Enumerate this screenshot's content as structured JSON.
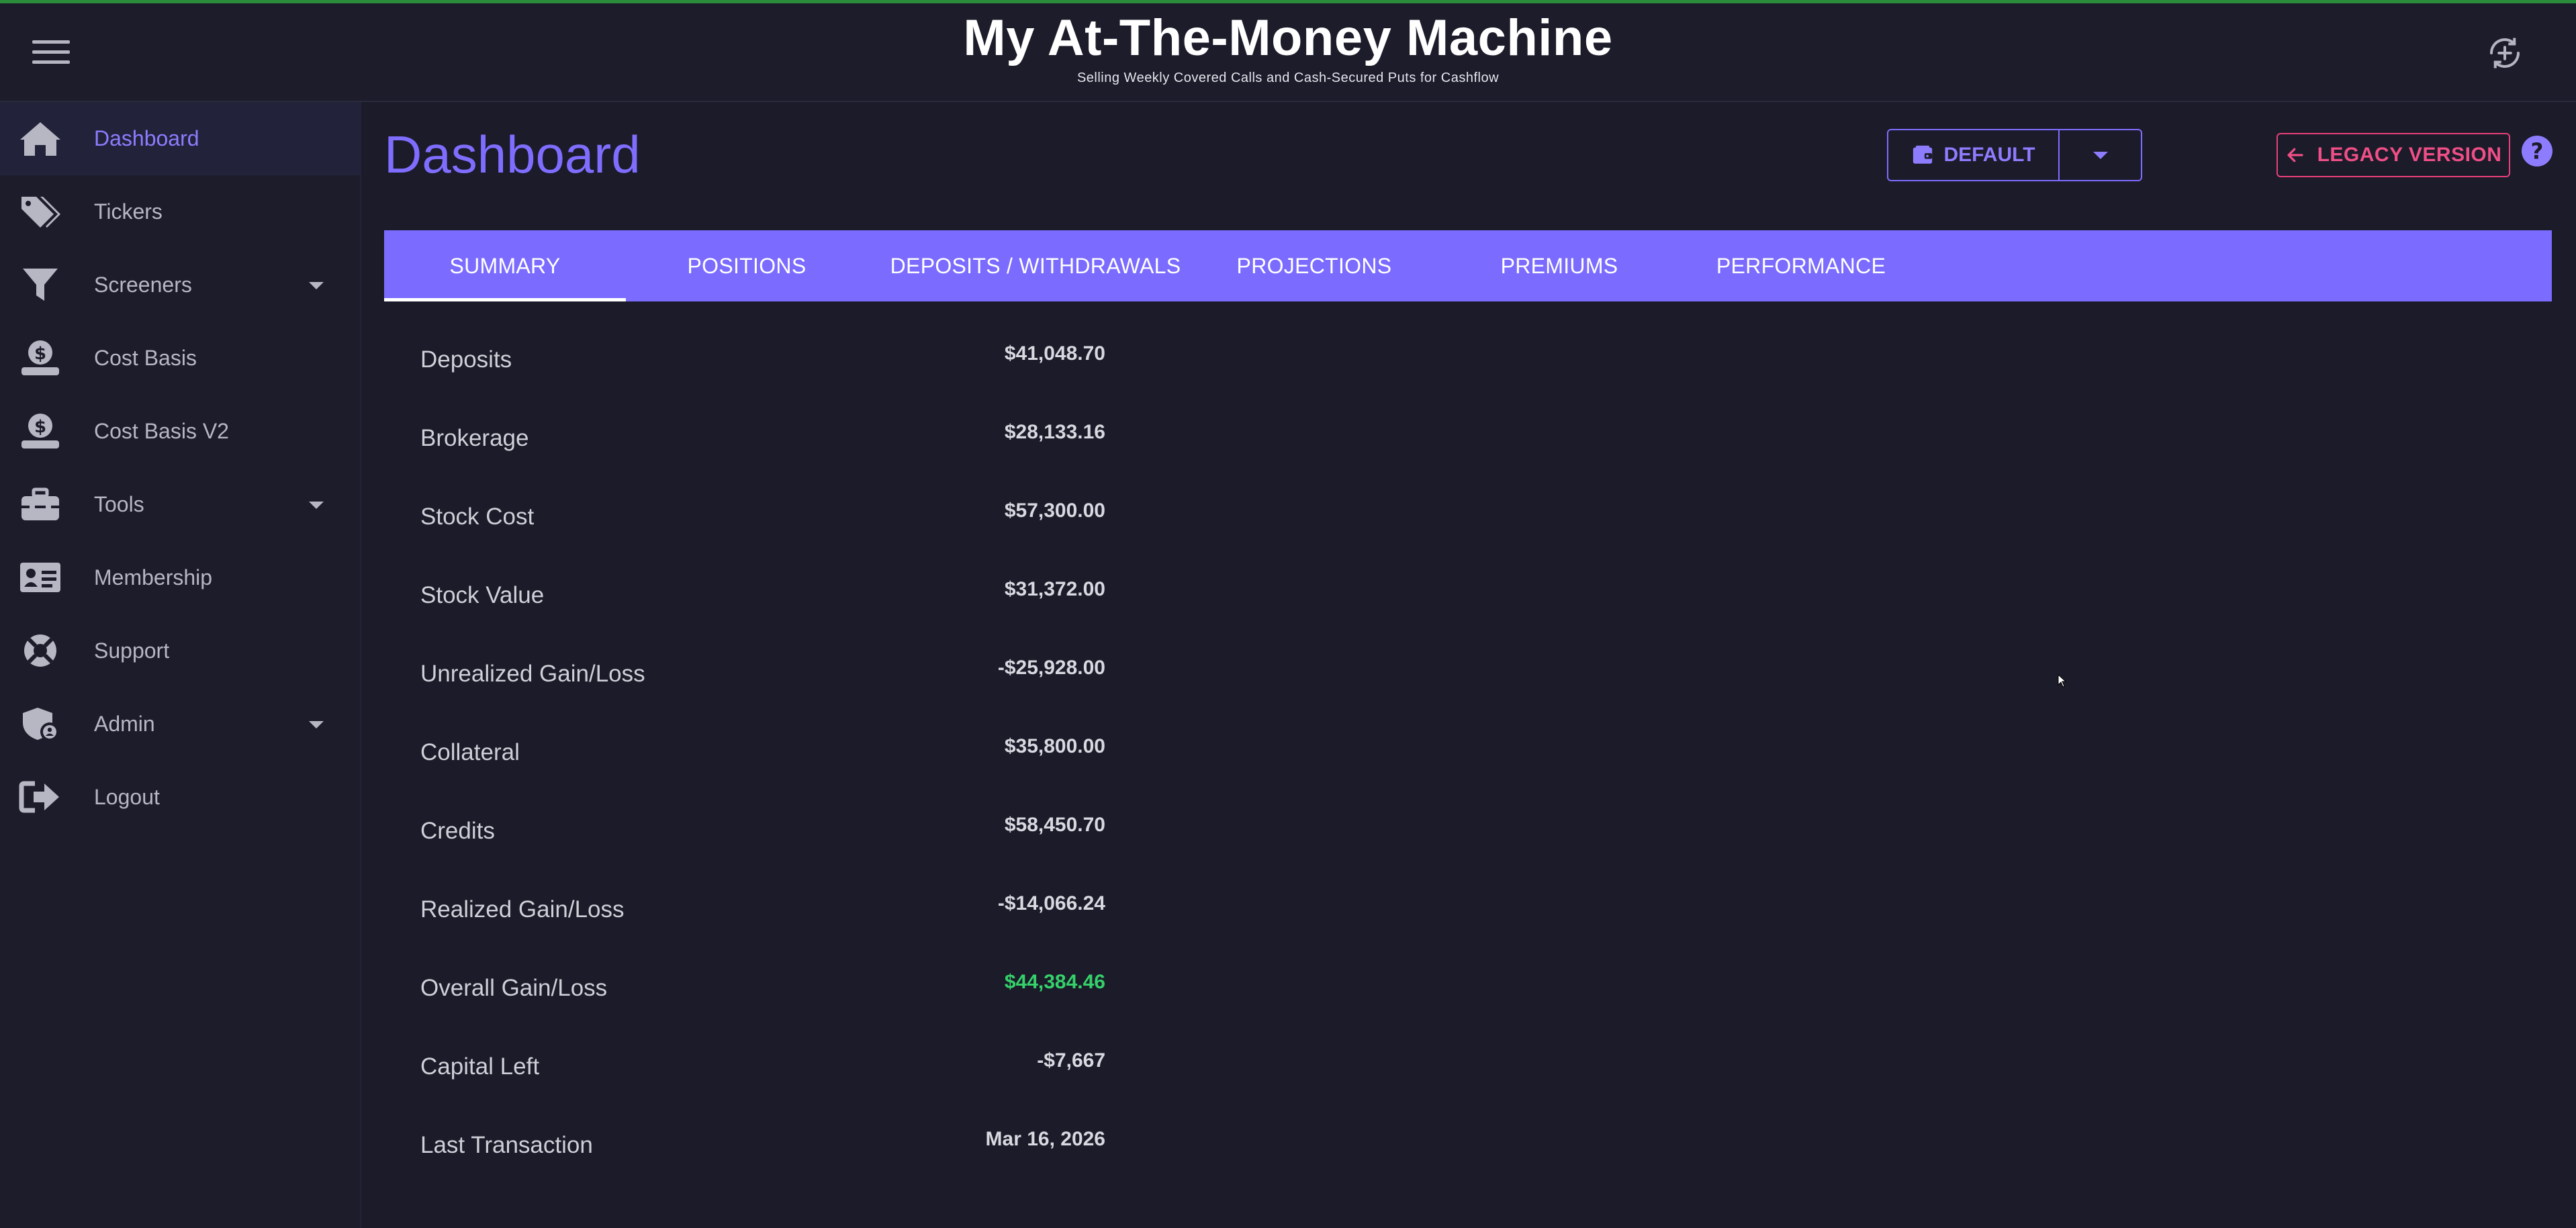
{
  "header": {
    "title": "My At-The-Money Machine",
    "subtitle": "Selling Weekly Covered Calls and Cash-Secured Puts for Cashflow",
    "menu_icon": "hamburger-menu-icon",
    "sync_icon": "sync-icon"
  },
  "sidebar": {
    "items": [
      {
        "label": "Dashboard",
        "icon": "home-icon",
        "active": true
      },
      {
        "label": "Tickers",
        "icon": "tags-icon"
      },
      {
        "label": "Screeners",
        "icon": "filter-icon",
        "expandable": true
      },
      {
        "label": "Cost Basis",
        "icon": "money-hand-icon"
      },
      {
        "label": "Cost Basis V2",
        "icon": "money-hand-icon"
      },
      {
        "label": "Tools",
        "icon": "toolbox-icon",
        "expandable": true
      },
      {
        "label": "Membership",
        "icon": "id-card-icon"
      },
      {
        "label": "Support",
        "icon": "life-ring-icon"
      },
      {
        "label": "Admin",
        "icon": "shield-user-icon",
        "expandable": true
      },
      {
        "label": "Logout",
        "icon": "sign-out-icon"
      }
    ]
  },
  "main": {
    "page_title": "Dashboard",
    "portfolio_button": "DEFAULT",
    "legacy_button": "LEGACY VERSION",
    "tabs": [
      {
        "label": "SUMMARY",
        "active": true
      },
      {
        "label": "POSITIONS"
      },
      {
        "label": "DEPOSITS / WITHDRAWALS"
      },
      {
        "label": "PROJECTIONS"
      },
      {
        "label": "PREMIUMS"
      },
      {
        "label": "PERFORMANCE"
      }
    ],
    "summary": [
      {
        "label": "Deposits",
        "value": "$41,048.70"
      },
      {
        "label": "Brokerage",
        "value": "$28,133.16"
      },
      {
        "label": "Stock Cost",
        "value": "$57,300.00"
      },
      {
        "label": "Stock Value",
        "value": "$31,372.00"
      },
      {
        "label": "Unrealized Gain/Loss",
        "value": "-$25,928.00"
      },
      {
        "label": "Collateral",
        "value": "$35,800.00"
      },
      {
        "label": "Credits",
        "value": "$58,450.70"
      },
      {
        "label": "Realized Gain/Loss",
        "value": "-$14,066.24"
      },
      {
        "label": "Overall Gain/Loss",
        "value": "$44,384.46",
        "positive": true
      },
      {
        "label": "Capital Left",
        "value": "-$7,667"
      },
      {
        "label": "Last Transaction",
        "value": "Mar 16, 2026"
      }
    ]
  },
  "colors": {
    "accent": "#7b6cff",
    "legacy": "#e8407a",
    "positive": "#35d16a",
    "background": "#1b1b29"
  }
}
